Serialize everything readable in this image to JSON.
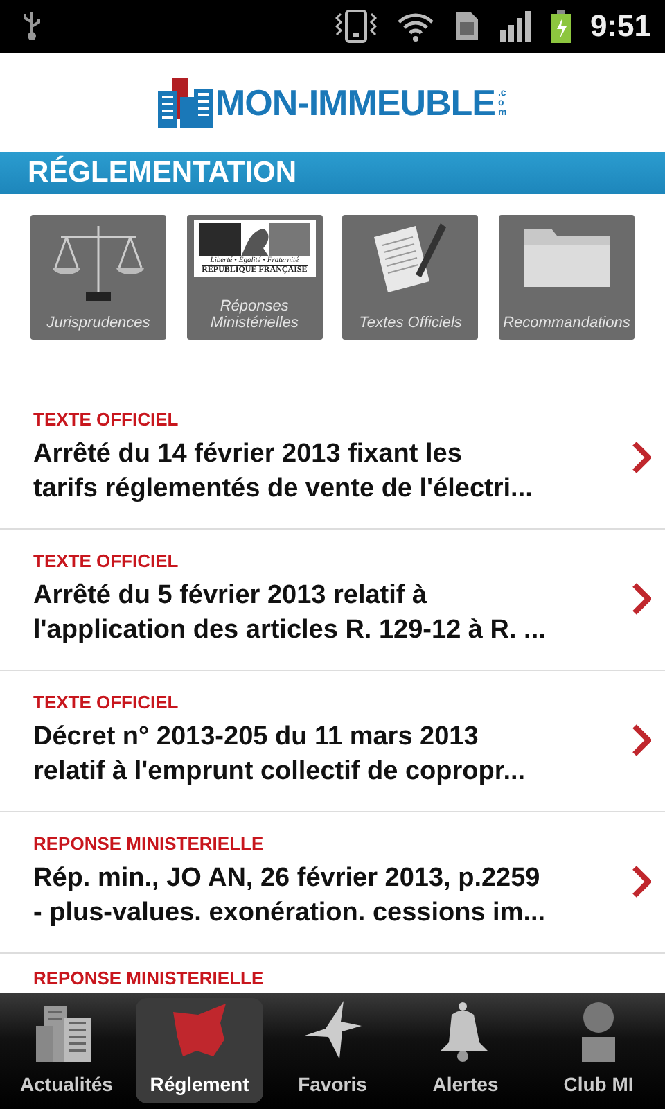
{
  "status_bar": {
    "time": "9:51"
  },
  "logo": {
    "name": "MON-IMMEUBLE",
    "suffix": ".com"
  },
  "section": {
    "title": "RÉGLEMENTATION"
  },
  "categories": [
    {
      "kind": "scales",
      "label": "Jurisprudences"
    },
    {
      "kind": "republic",
      "label": "Réponses Ministérielles",
      "motto": "Liberté • Égalité • Fraternité",
      "emblem": "RÉPUBLIQUE FRANÇAISE"
    },
    {
      "kind": "document",
      "label": "Textes Officiels"
    },
    {
      "kind": "folder",
      "label": "Recommandations"
    }
  ],
  "items": [
    {
      "category": "TEXTE OFFICIEL",
      "title_lines": [
        "Arrêté du 14 février 2013 fixant les",
        "tarifs réglementés de vente de l'électri..."
      ]
    },
    {
      "category": "TEXTE OFFICIEL",
      "title_lines": [
        "Arrêté du 5 février 2013 relatif à",
        "l'application des articles R. 129-12 à R. ..."
      ]
    },
    {
      "category": "TEXTE OFFICIEL",
      "title_lines": [
        "Décret n° 2013-205 du 11 mars 2013",
        "relatif à l'emprunt collectif de copropr..."
      ]
    },
    {
      "category": "REPONSE MINISTERIELLE",
      "title_lines": [
        "Rép. min., JO AN, 26 février 2013, p.2259",
        "- plus-values. exonération. cessions im..."
      ]
    },
    {
      "category": "REPONSE MINISTERIELLE"
    }
  ],
  "tabs": [
    {
      "kind": "buildings",
      "label": "Actualités",
      "selected": false
    },
    {
      "kind": "map",
      "label": "Réglement",
      "selected": true
    },
    {
      "kind": "star",
      "label": "Favoris",
      "selected": false
    },
    {
      "kind": "bell",
      "label": "Alertes",
      "selected": false
    },
    {
      "kind": "person",
      "label": "Club MI",
      "selected": false
    }
  ]
}
